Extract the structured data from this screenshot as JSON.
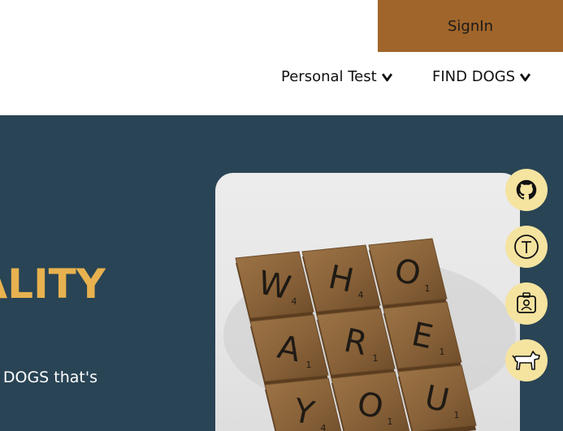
{
  "header": {
    "signin_label": "SignIn"
  },
  "nav": {
    "items": [
      {
        "label": "Personal Test",
        "icon": "caret-down-icon"
      },
      {
        "label": "FIND DOGS",
        "icon": "caret-down-icon"
      }
    ]
  },
  "hero": {
    "title_fragment": "ALITY",
    "text_fragment": "DOGS that's",
    "image": {
      "tiles": [
        {
          "letter": "W",
          "sub": "4"
        },
        {
          "letter": "H",
          "sub": "4"
        },
        {
          "letter": "O",
          "sub": "1"
        },
        {
          "letter": "A",
          "sub": "1"
        },
        {
          "letter": "R",
          "sub": "1"
        },
        {
          "letter": "E",
          "sub": "1"
        },
        {
          "letter": "Y",
          "sub": "4"
        },
        {
          "letter": "O",
          "sub": "1"
        },
        {
          "letter": "U",
          "sub": "1"
        }
      ]
    }
  },
  "side_icons": [
    {
      "icon": "github-icon"
    },
    {
      "icon": "letter-t-icon"
    },
    {
      "icon": "id-badge-icon"
    },
    {
      "icon": "dog-icon"
    }
  ],
  "colors": {
    "accent": "#a0652a",
    "hero_bg": "#294455",
    "title": "#e7b24f",
    "icon_bg": "#f5e3a0"
  }
}
